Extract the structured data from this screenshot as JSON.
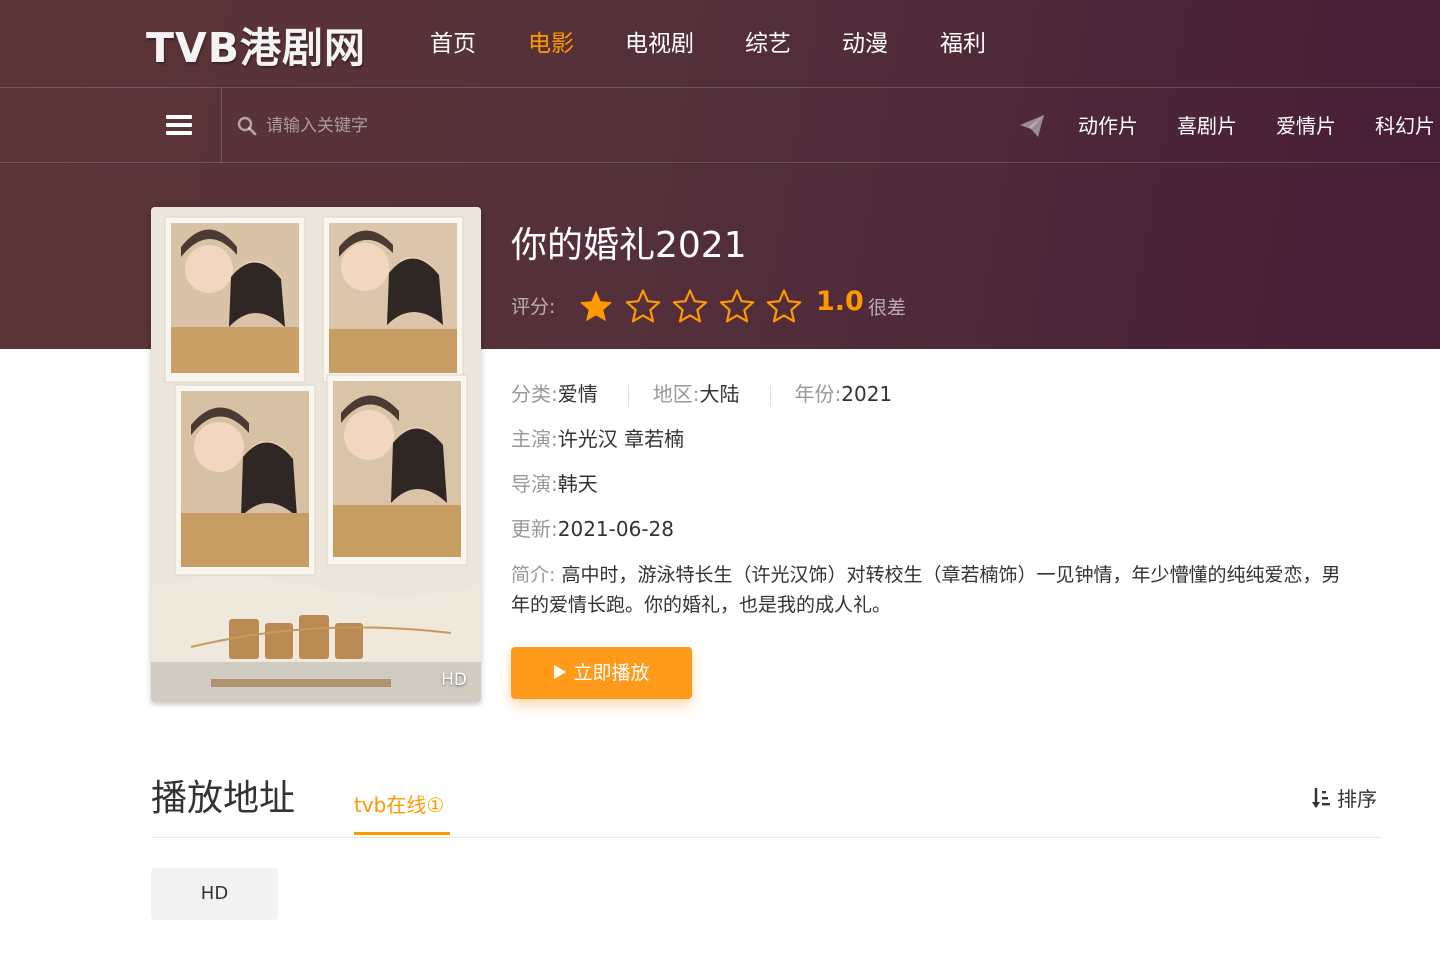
{
  "site": {
    "logo": "TVB港剧网"
  },
  "nav": {
    "items": [
      {
        "label": "首页",
        "active": false
      },
      {
        "label": "电影",
        "active": true
      },
      {
        "label": "电视剧",
        "active": false
      },
      {
        "label": "综艺",
        "active": false
      },
      {
        "label": "动漫",
        "active": false
      },
      {
        "label": "福利",
        "active": false
      }
    ]
  },
  "subnav": {
    "menu_icon": "hamburger-icon",
    "search_icon": "search-icon",
    "search_placeholder": "请输入关键字",
    "send_icon": "paper-plane-icon",
    "categories": [
      "动作片",
      "喜剧片",
      "爱情片",
      "科幻片"
    ]
  },
  "movie": {
    "title": "你的婚礼2021",
    "poster_badge": "HD",
    "rating_label": "评分:",
    "rating_stars_filled": 1,
    "rating_stars_total": 5,
    "score": "1.0",
    "verdict": "很差",
    "category_label": "分类:",
    "category": "爱情",
    "region_label": "地区:",
    "region": "大陆",
    "year_label": "年份:",
    "year": "2021",
    "cast_label": "主演:",
    "cast": "许光汉 章若楠",
    "director_label": "导演:",
    "director": "韩天",
    "updated_label": "更新:",
    "updated": "2021-06-28",
    "synopsis_label": "简介:",
    "synopsis_line1": "高中时，游泳特长生（许光汉饰）对转校生（章若楠饰）一见钟情，年少懵懂的纯纯爱恋，男",
    "synopsis_line2": "年的爱情长跑。你的婚礼，也是我的成人礼。",
    "play_label": "立即播放"
  },
  "playlist": {
    "title": "播放地址",
    "source_tab": "tvb在线①",
    "sort_label": "排序",
    "sort_icon": "sort-icon",
    "episodes": [
      "HD"
    ]
  },
  "colors": {
    "accent": "#ff9900",
    "header_bg_start": "#5e3536",
    "header_bg_end": "#481d38",
    "button_bg": "#ff9a1a"
  }
}
